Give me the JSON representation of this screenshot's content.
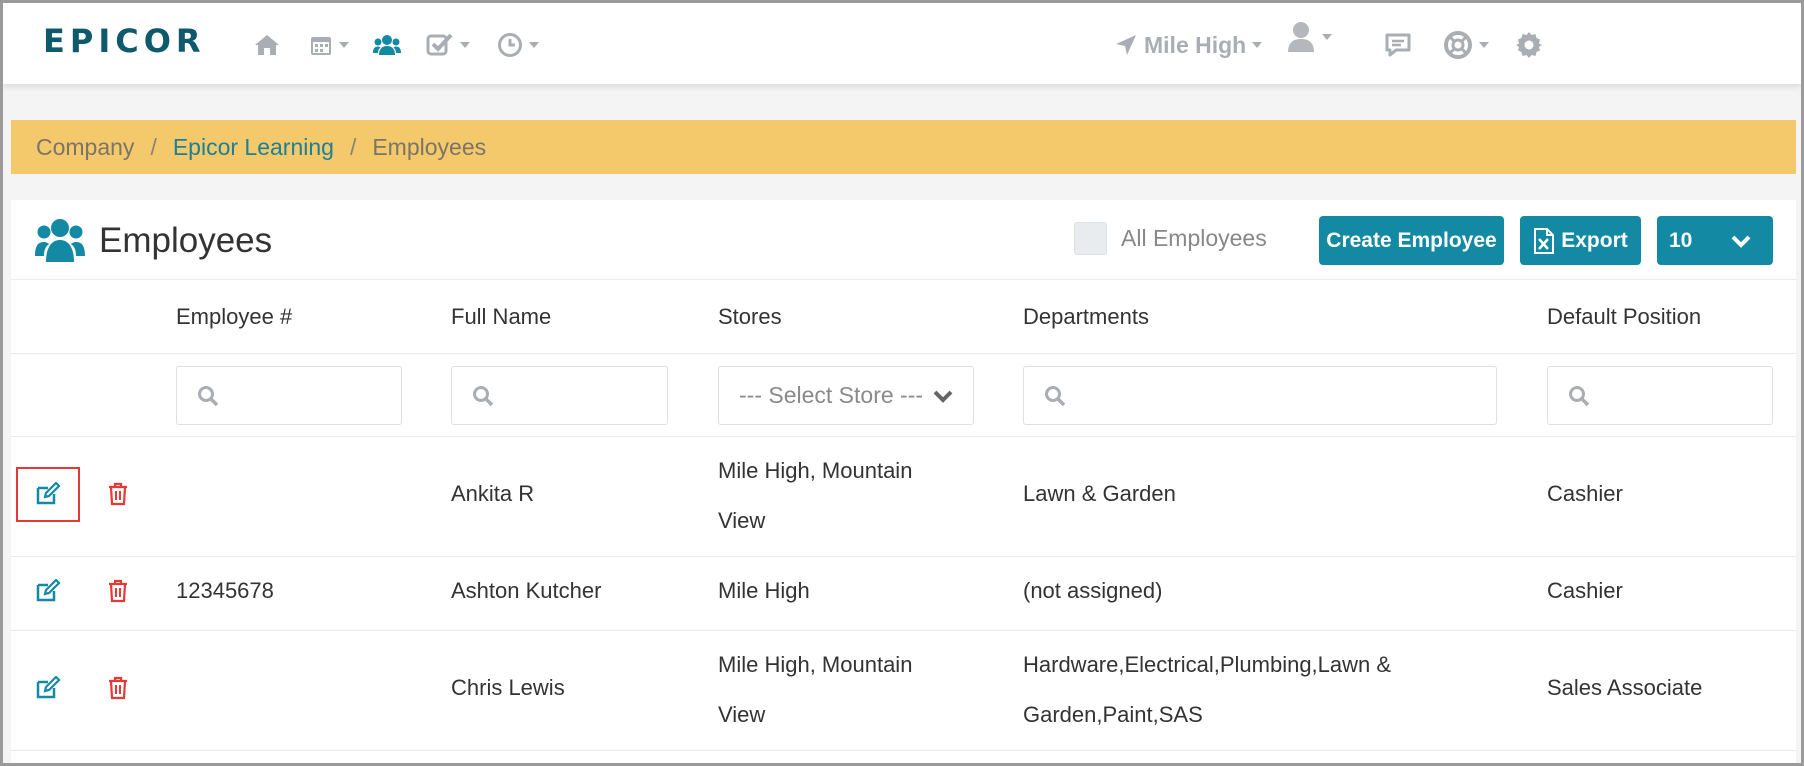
{
  "brand": {
    "logo_text": "epicor"
  },
  "nav": {
    "location_label": "Mile High",
    "icons": [
      "home-icon",
      "calendar-icon",
      "users-icon",
      "tasks-icon",
      "clock-icon",
      "location-arrow-icon",
      "user-icon",
      "comment-icon",
      "help-icon",
      "gear-icon"
    ]
  },
  "breadcrumb": {
    "items": [
      "Company",
      "Epicor Learning",
      "Employees"
    ],
    "separator": "/"
  },
  "panel": {
    "title": "Employees",
    "all_employees_label": "All Employees",
    "create_button": "Create Employee",
    "export_button": "Export",
    "page_size": "10"
  },
  "table": {
    "columns": [
      "Employee #",
      "Full Name",
      "Stores",
      "Departments",
      "Default Position"
    ],
    "store_select_placeholder": "--- Select Store ---",
    "rows": [
      {
        "employee_no": "",
        "full_name": "Ankita R",
        "stores_line1": "Mile High, Mountain",
        "stores_line2": "View",
        "departments_line1": "Lawn & Garden",
        "departments_line2": "",
        "position": "Cashier"
      },
      {
        "employee_no": "12345678",
        "full_name": "Ashton Kutcher",
        "stores_line1": "Mile High",
        "stores_line2": "",
        "departments_line1": "(not assigned)",
        "departments_line2": "",
        "position": "Cashier"
      },
      {
        "employee_no": "",
        "full_name": "Chris Lewis",
        "stores_line1": "Mile High, Mountain",
        "stores_line2": "View",
        "departments_line1": "Hardware,Electrical,Plumbing,Lawn &",
        "departments_line2": "Garden,Paint,SAS",
        "position": "Sales Associate"
      }
    ]
  },
  "colors": {
    "brand": "#0e5a6b",
    "accent": "#1389a4",
    "breadcrumb_bg": "#f3c96b",
    "delete": "#e53935"
  }
}
